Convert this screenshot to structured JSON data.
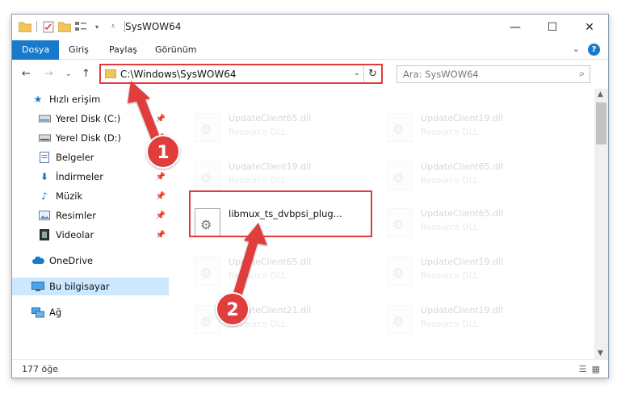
{
  "window": {
    "title": "SysWOW64",
    "minimize_icon": "minimize-icon",
    "maximize_icon": "maximize-icon",
    "close_icon": "close-icon"
  },
  "ribbon": {
    "tabs": [
      {
        "label": "Dosya",
        "active": true
      },
      {
        "label": "Giriş",
        "active": false
      },
      {
        "label": "Paylaş",
        "active": false
      },
      {
        "label": "Görünüm",
        "active": false
      }
    ]
  },
  "address": {
    "path": "C:\\Windows\\SysWOW64",
    "search_placeholder": "Ara: SysWOW64"
  },
  "nav": {
    "items": [
      {
        "label": "Hızlı erişim",
        "icon": "star-icon",
        "pinned": false,
        "selected": false
      },
      {
        "label": "Yerel Disk (C:)",
        "icon": "drive-icon",
        "pinned": true,
        "selected": false
      },
      {
        "label": "Yerel Disk (D:)",
        "icon": "drive-icon",
        "pinned": true,
        "selected": false
      },
      {
        "label": "Belgeler",
        "icon": "documents-icon",
        "pinned": true,
        "selected": false
      },
      {
        "label": "İndirmeler",
        "icon": "download-icon",
        "pinned": true,
        "selected": false
      },
      {
        "label": "Müzik",
        "icon": "music-icon",
        "pinned": true,
        "selected": false
      },
      {
        "label": "Resimler",
        "icon": "pictures-icon",
        "pinned": true,
        "selected": false
      },
      {
        "label": "Videolar",
        "icon": "videos-icon",
        "pinned": true,
        "selected": false
      },
      {
        "label": "OneDrive",
        "icon": "cloud-icon",
        "pinned": false,
        "selected": false
      },
      {
        "label": "Bu bilgisayar",
        "icon": "computer-icon",
        "pinned": false,
        "selected": true
      },
      {
        "label": "Ağ",
        "icon": "network-icon",
        "pinned": false,
        "selected": false
      }
    ]
  },
  "files": [
    {
      "name": "UpdateClient65.dll",
      "type": "Resource DLL",
      "highlighted": false
    },
    {
      "name": "UpdateClient19.dll",
      "type": "Resource DLL",
      "highlighted": false
    },
    {
      "name": "UpdateClient19.dll",
      "type": "Resource DLL",
      "highlighted": false
    },
    {
      "name": "UpdateClient65.dll",
      "type": "Resource DLL",
      "highlighted": false
    },
    {
      "name": "libmux_ts_dvbpsi_plug...",
      "type": "",
      "highlighted": true
    },
    {
      "name": "UpdateClient65.dll",
      "type": "Resource DLL",
      "highlighted": false
    },
    {
      "name": "UpdateClient65.dll",
      "type": "Resource DLL",
      "highlighted": false
    },
    {
      "name": "UpdateClient19.dll",
      "type": "Resource DLL",
      "highlighted": false
    },
    {
      "name": "UpdateClient21.dll",
      "type": "Resource DLL",
      "highlighted": false
    },
    {
      "name": "UpdateClient19.dll",
      "type": "Resource DLL",
      "highlighted": false
    }
  ],
  "status": {
    "count": "177 öğe"
  },
  "annotations": {
    "step1": "1",
    "step2": "2",
    "color": "#e03c3c"
  },
  "colors": {
    "accent": "#1979ca",
    "selection": "#cce8ff",
    "annotation": "#e03c3c"
  }
}
